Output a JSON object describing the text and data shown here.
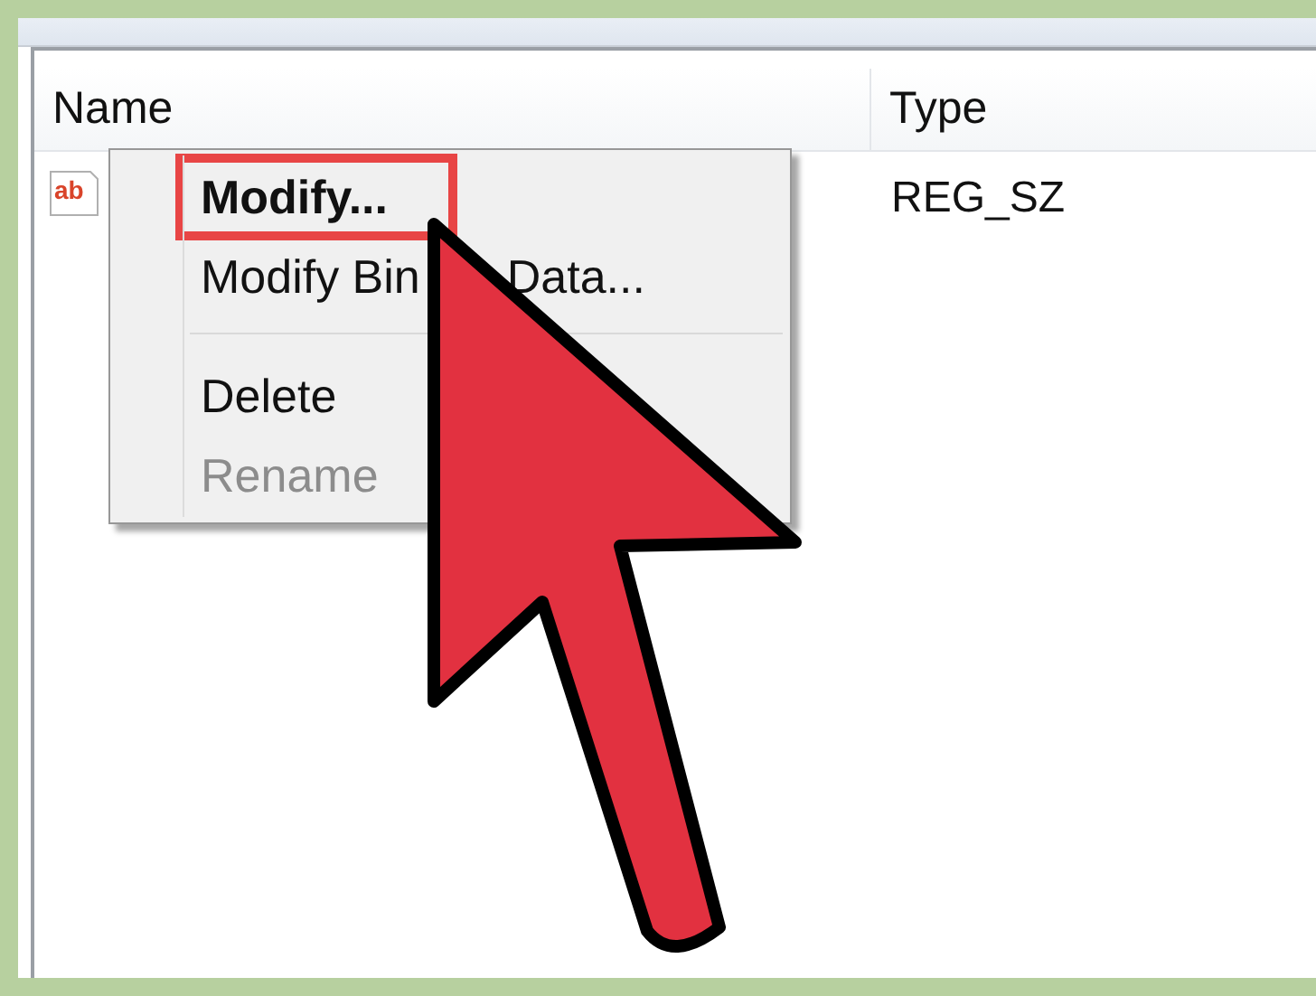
{
  "columns": [
    "Name",
    "Type"
  ],
  "rows": [
    {
      "icon_label": "ab",
      "type": "REG_SZ"
    }
  ],
  "context_menu": {
    "items": [
      {
        "kind": "item",
        "parts": [
          "Modify..."
        ],
        "bold": true,
        "disabled": false,
        "outlined": true
      },
      {
        "kind": "item",
        "parts": [
          "Modify Bin",
          "Data..."
        ],
        "bold": false,
        "disabled": false,
        "outlined": false
      },
      {
        "kind": "separator"
      },
      {
        "kind": "item",
        "parts": [
          "Delete"
        ],
        "bold": false,
        "disabled": false,
        "outlined": false
      },
      {
        "kind": "item",
        "parts": [
          "Rename"
        ],
        "bold": false,
        "disabled": true,
        "outlined": false
      }
    ]
  }
}
